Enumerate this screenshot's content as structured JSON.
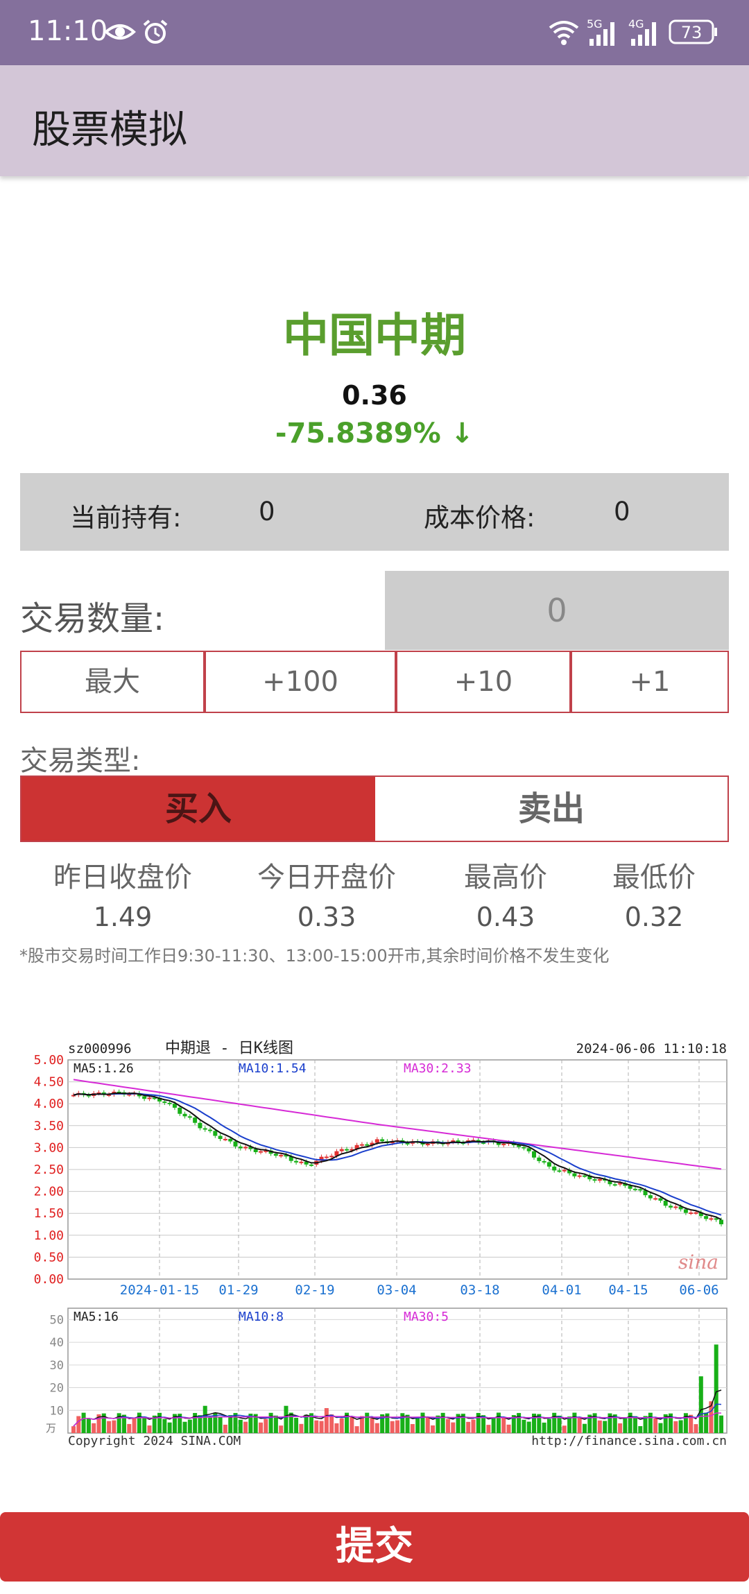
{
  "status_bar": {
    "time": "11:10",
    "net1": "5G",
    "net2": "4G",
    "battery": "73",
    "icons": [
      "eye-icon",
      "alarm-icon",
      "wifi-icon",
      "signal-5g-icon",
      "signal-4g-icon",
      "battery-icon"
    ]
  },
  "app_bar": {
    "title": "股票模拟"
  },
  "stock": {
    "name": "中国中期",
    "price": "0.36",
    "change": "-75.8389% ↓",
    "change_color": "#4aa02a"
  },
  "holding": {
    "held_label": "当前持有:",
    "held_value": "0",
    "cost_label": "成本价格:",
    "cost_value": "0"
  },
  "quantity": {
    "label": "交易数量:",
    "value": "0",
    "buttons": [
      "最大",
      "+100",
      "+10",
      "+1"
    ]
  },
  "trade_type": {
    "label": "交易类型:",
    "buy": "买入",
    "sell": "卖出",
    "buy_color": "#cc3333"
  },
  "stats": [
    {
      "label": "昨日收盘价",
      "value": "1.49"
    },
    {
      "label": "今日开盘价",
      "value": "0.33"
    },
    {
      "label": "最高价",
      "value": "0.43"
    },
    {
      "label": "最低价",
      "value": "0.32"
    }
  ],
  "note": "*股市交易时间工作日9:30-11:30、13:00-15:00开市,其余时间价格不发生变化",
  "kline": {
    "code": "sz000996",
    "title": "中期退 - 日K线图",
    "datetime": "2024-06-06 11:10:18",
    "ma5": "MA5:1.26",
    "ma10": "MA10:1.54",
    "ma30": "MA30:2.33",
    "y_ticks": [
      "5.00",
      "4.50",
      "4.00",
      "3.50",
      "3.00",
      "2.50",
      "2.00",
      "1.50",
      "1.00",
      "0.50",
      "0.00"
    ],
    "x_ticks": [
      "2024-01-15",
      "01-29",
      "02-19",
      "03-04",
      "03-18",
      "04-01",
      "04-15",
      "06-06"
    ],
    "vol_ma5": "MA5:16",
    "vol_ma10": "MA10:8",
    "vol_ma30": "MA30:5",
    "vol_ticks": [
      "50",
      "40",
      "30",
      "20",
      "10"
    ],
    "vol_unit": "万",
    "watermark": "sina",
    "copyright": "Copyright 2024 SINA.COM",
    "url": "http://finance.sina.com.cn"
  },
  "submit": "提交"
}
